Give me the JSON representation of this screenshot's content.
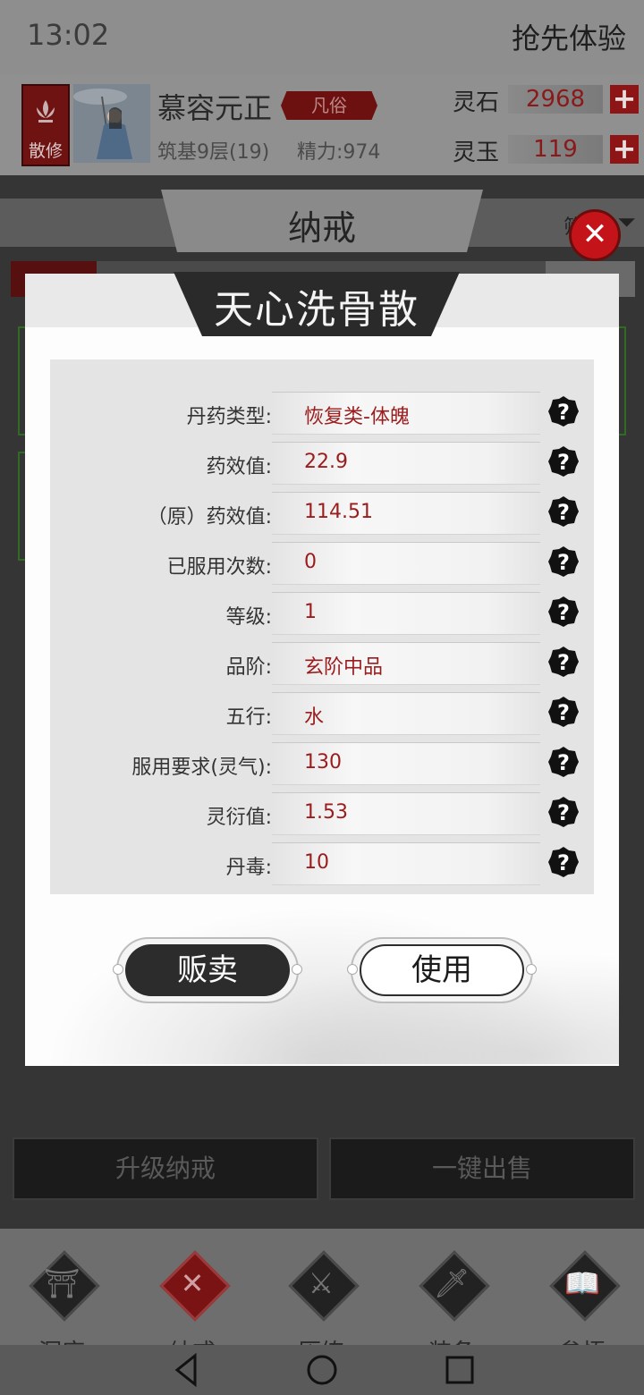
{
  "status_bar": {
    "time": "13:02",
    "early_access": "抢先体验"
  },
  "player": {
    "sect": "散修",
    "name": "慕容元正",
    "rank": "凡俗",
    "level": "筑基9层(19)",
    "energy": "精力:974",
    "resources": [
      {
        "label": "灵石",
        "value": "2968"
      },
      {
        "label": "灵玉",
        "value": "119"
      }
    ]
  },
  "bag": {
    "title": "纳戒",
    "filter": "筛"
  },
  "dialog": {
    "title": "天心洗骨散",
    "rows": [
      {
        "label": "丹药类型:",
        "value": "恢复类-体魄"
      },
      {
        "label": "药效值:",
        "value": "22.9"
      },
      {
        "label": "（原）药效值:",
        "value": "114.51"
      },
      {
        "label": "已服用次数:",
        "value": "0"
      },
      {
        "label": "等级:",
        "value": "1"
      },
      {
        "label": "品阶:",
        "value": "玄阶中品"
      },
      {
        "label": "五行:",
        "value": "水"
      },
      {
        "label": "服用要求(灵气):",
        "value": "130"
      },
      {
        "label": "灵衍值:",
        "value": "1.53"
      },
      {
        "label": "丹毒:",
        "value": "10"
      }
    ],
    "sell_label": "贩卖",
    "use_label": "使用"
  },
  "bottom_actions": {
    "upgrade": "升级纳戒",
    "sell_all": "一键出售"
  },
  "nav": [
    {
      "label": "洞府",
      "icon": "gate-icon"
    },
    {
      "label": "纳戒",
      "icon": "ring-icon"
    },
    {
      "label": "历练",
      "icon": "crossed-swords-icon"
    },
    {
      "label": "装备",
      "icon": "sword-icon"
    },
    {
      "label": "参悟",
      "icon": "book-icon"
    }
  ],
  "colors": {
    "accent_red": "#9a1c1c",
    "close_red": "#c4141a",
    "dark": "#2c2c2c"
  }
}
